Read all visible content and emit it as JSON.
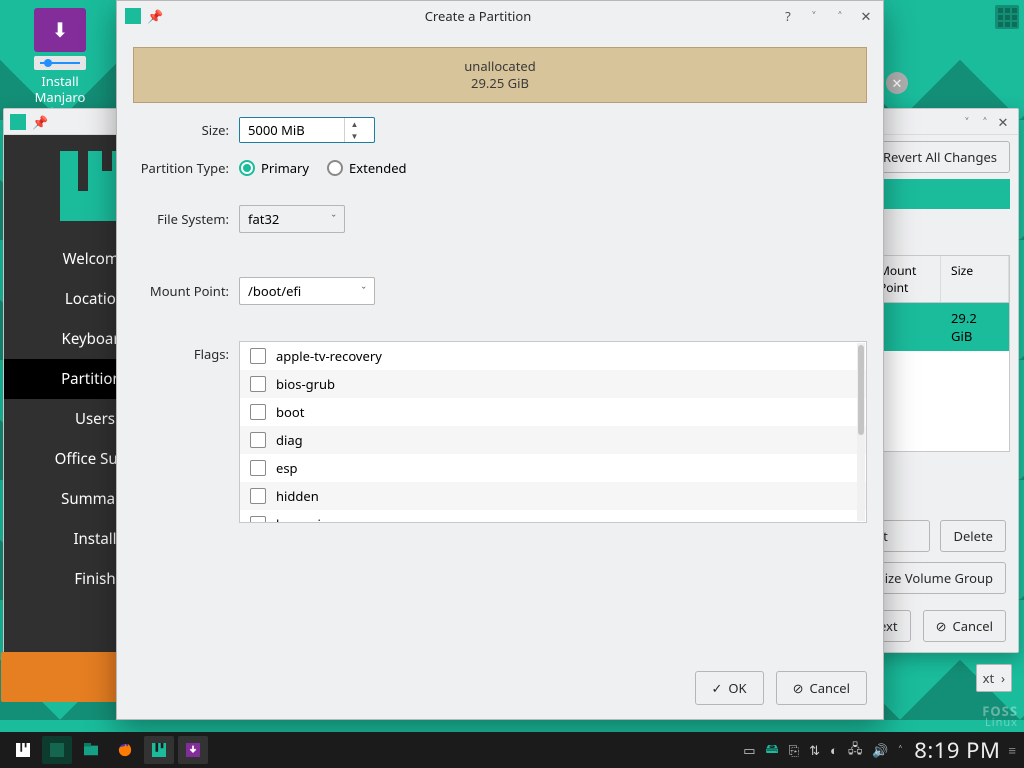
{
  "desktop": {
    "icon_label": "Install Manjaro Linux"
  },
  "installer": {
    "titlebar": {
      "pin_on": true
    },
    "sidebar": {
      "items": [
        {
          "label": "Welcome"
        },
        {
          "label": "Location"
        },
        {
          "label": "Keyboard"
        },
        {
          "label": "Partitions"
        },
        {
          "label": "Users"
        },
        {
          "label": "Office Suite"
        },
        {
          "label": "Summary"
        },
        {
          "label": "Install"
        },
        {
          "label": "Finish"
        }
      ],
      "active_index": 3
    },
    "main": {
      "revert_label": "Revert All Changes",
      "table_headers": {
        "mount": "Mount Point",
        "size": "Size"
      },
      "free_row_size": "29.2 GiB",
      "btn_delete": "Delete",
      "btn_vol_group": "Resize Volume Group",
      "btn_next": "Next",
      "btn_cancel": "Cancel"
    }
  },
  "dialog": {
    "title": "Create a Partition",
    "unallocated": {
      "label": "unallocated",
      "size": "29.25 GiB"
    },
    "labels": {
      "size": "Size:",
      "ptype": "Partition Type:",
      "fs": "File System:",
      "mount": "Mount Point:",
      "flags": "Flags:"
    },
    "size_value": "5000 MiB",
    "ptype": {
      "primary": "Primary",
      "extended": "Extended",
      "selected": "primary"
    },
    "fs_value": "fat32",
    "mount_value": "/boot/efi",
    "flags": [
      "apple-tv-recovery",
      "bios-grub",
      "boot",
      "diag",
      "esp",
      "hidden",
      "hpservice"
    ],
    "buttons": {
      "ok": "OK",
      "cancel": "Cancel"
    }
  },
  "taskbar": {
    "clock": "8:19 PM"
  },
  "watermark": {
    "line1": "FOSS",
    "line2": "Linux"
  }
}
